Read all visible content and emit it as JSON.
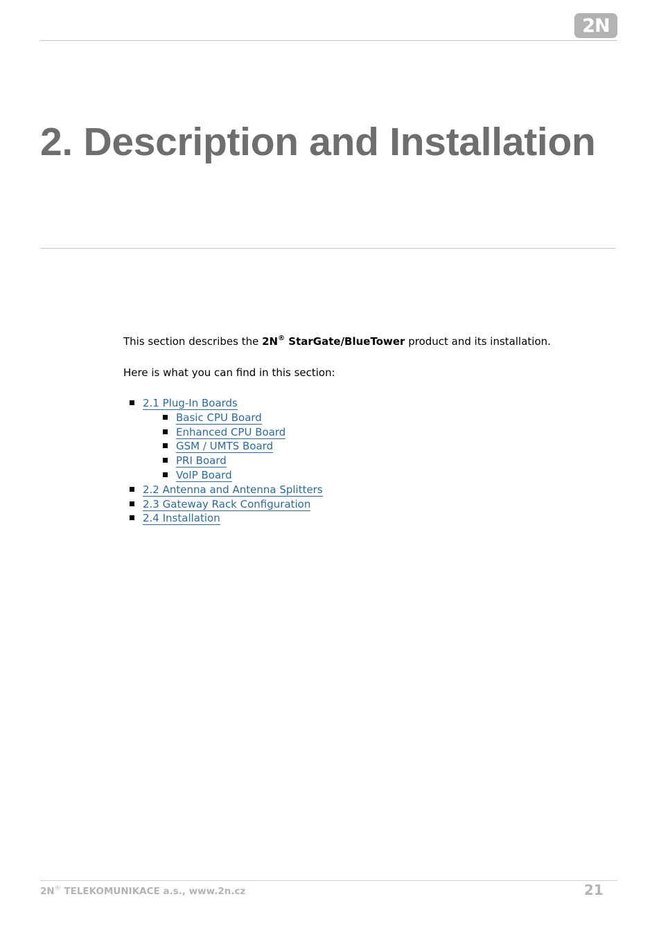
{
  "header": {
    "logo_text": "2N"
  },
  "title": "2. Description and Installation",
  "intro": {
    "before": "This section describes the ",
    "brand": "2N",
    "registered": "®",
    "product": " StarGate/BlueTower",
    "after": " product and its installation."
  },
  "lead": "Here is what you can find in this section:",
  "toc": [
    {
      "label": "2.1 Plug-In Boards",
      "children": [
        {
          "label": "Basic CPU Board"
        },
        {
          "label": "Enhanced CPU Board"
        },
        {
          "label": "GSM / UMTS Board"
        },
        {
          "label": "PRI Board"
        },
        {
          "label": "VoIP Board"
        }
      ]
    },
    {
      "label": "2.2 Antenna and Antenna Splitters"
    },
    {
      "label": "2.3 Gateway Rack Configuration"
    },
    {
      "label": "2.4 Installation"
    }
  ],
  "footer": {
    "brand": "2N",
    "registered": "®",
    "company": " TELEKOMUNIKACE a.s., www.2n.cz",
    "page_number": "21"
  },
  "colors": {
    "link": "#2b69a3",
    "title": "#6e6e6e",
    "footer": "#b3b3b3"
  }
}
